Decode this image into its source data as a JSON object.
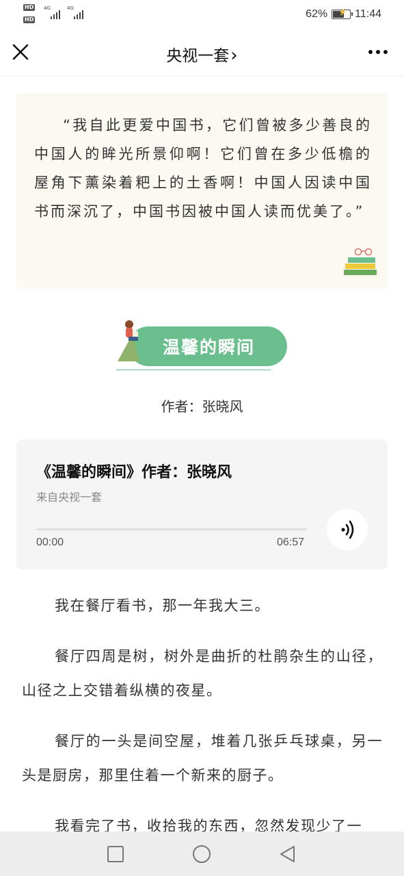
{
  "status_bar": {
    "sim1": "HD 1",
    "sim2": "HD 2",
    "net1": "4G",
    "net2": "4G",
    "battery": "62%",
    "battery_level": 0.62,
    "time": "11:44"
  },
  "nav": {
    "title": "央视一套",
    "chevron": "›",
    "close_icon": "close-icon",
    "more_icon": "more-icon"
  },
  "quote": {
    "text": "“我自此更爱中国书，它们曾被多少善良的中国人的眸光所景仰啊！它们曾在多少低檐的屋角下薰染着粑上的土香啊！中国人因读中国书而深沉了，中国书因被中国人读而优美了。”"
  },
  "badge": {
    "title": "温馨的瞬间",
    "color": "#6bbf8e"
  },
  "author": "作者：张晓风",
  "audio": {
    "title": "《温馨的瞬间》作者：张晓风",
    "source": "来自央视一套",
    "time_current": "00:00",
    "time_total": "06:57",
    "progress": 0
  },
  "article": {
    "paragraphs": [
      "我在餐厅看书，那一年我大三。",
      "餐厅四周是树，树外是曲折的杜鹃杂生的山径，山径之上交错着纵横的夜星。",
      "餐厅的一头是间空屋，堆着几张乒乓球桌，另一头是厨房，那里住着一个新来的厨子。",
      "我看完了书，收拾我的东西，忽然发现少了一"
    ]
  },
  "system_nav": {
    "recent": "square-icon",
    "home": "circle-icon",
    "back": "triangle-back-icon"
  }
}
